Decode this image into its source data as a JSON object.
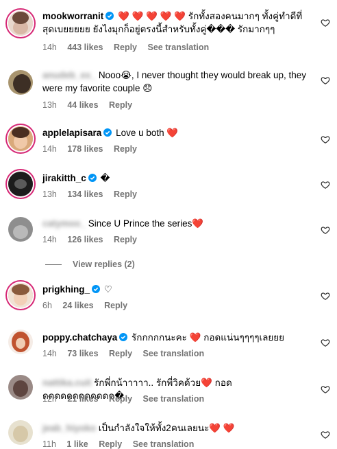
{
  "comments": [
    {
      "user": "mookworranit",
      "verified": true,
      "text": "❤️ ❤️ ❤️ ❤️ ❤️ รักทั้งสองคนมากๆ ทั้งคู่ทำดีที่สุดเบยยยยย ยังไงมุกก็อยู่ตรงนี้สำหรับทั้งคู่��� รักมากๆๆ",
      "time": "14h",
      "likes": "443 likes",
      "reply": "Reply",
      "translate": "See translation"
    },
    {
      "user": "anudeb_ex_",
      "verified": false,
      "text": "Nooo😭, I never thought they would break up, they were my favorite couple 😞",
      "time": "13h",
      "likes": "44 likes",
      "reply": "Reply",
      "translate": ""
    },
    {
      "user": "applelapisara",
      "verified": true,
      "text": "Love u both ❤️",
      "time": "14h",
      "likes": "178 likes",
      "reply": "Reply",
      "translate": ""
    },
    {
      "user": "jirakitth_c",
      "verified": true,
      "text": "�",
      "time": "13h",
      "likes": "134 likes",
      "reply": "Reply",
      "translate": ""
    },
    {
      "user": "catymoo_",
      "verified": false,
      "text": "Since U Prince the series❤️",
      "time": "14h",
      "likes": "126 likes",
      "reply": "Reply",
      "translate": ""
    },
    {
      "user": "prigkhing_",
      "verified": true,
      "text": "♡",
      "time": "6h",
      "likes": "24 likes",
      "reply": "Reply",
      "translate": ""
    },
    {
      "user": "poppy.chatchaya",
      "verified": true,
      "text": "รักกกกกนะคะ ❤️ กอดแน่นๆๆๆๆเลยยย",
      "time": "14h",
      "likes": "73 likes",
      "reply": "Reply",
      "translate": "See translation"
    },
    {
      "user": "nattika.cuit",
      "verified": false,
      "text": "รักพี่กน้าาาาา.. รักพี่วิคด้วย❤️ กอดดดดดดดดดดดดด�",
      "time": "12h",
      "likes": "21 likes",
      "reply": "Reply",
      "translate": "See translation"
    },
    {
      "user": "jeab_hiyoko",
      "verified": false,
      "text": "เป็นกำลังใจให้ทั้ง2คนเลยนะ❤️ ❤️",
      "time": "11h",
      "likes": "1 like",
      "reply": "Reply",
      "translate": "See translation"
    }
  ],
  "view_replies": "View replies (2)",
  "colors": {
    "meta": "#737373",
    "verified": "#0095f6",
    "heart": "#ed1c24",
    "ring": "#d62976"
  }
}
